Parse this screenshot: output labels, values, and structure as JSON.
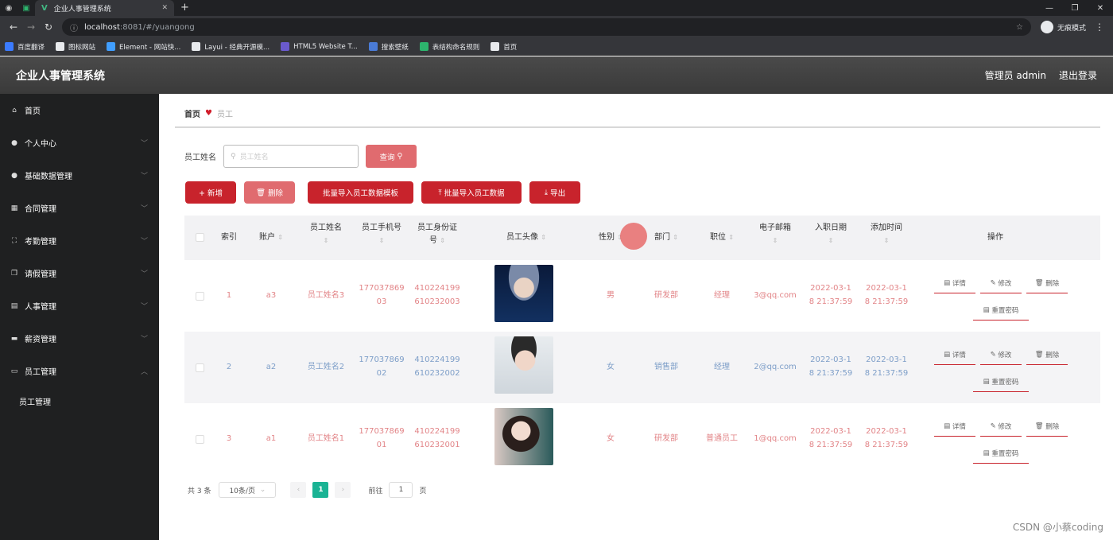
{
  "browser": {
    "tab_title": "企业人事管理系统",
    "url_host": "localhost",
    "url_path": ":8081/#/yuangong",
    "incognito_label": "无痕模式",
    "bookmarks": [
      {
        "label": "百度翻译",
        "color": "#3b7bff"
      },
      {
        "label": "图标网站",
        "color": "#e8eaed"
      },
      {
        "label": "Element - 网站快...",
        "color": "#409eff"
      },
      {
        "label": "Layui - 经典开源模...",
        "color": "#e8eaed"
      },
      {
        "label": "HTML5 Website T...",
        "color": "#6a5acd"
      },
      {
        "label": "搜索壁纸",
        "color": "#4a7bd6"
      },
      {
        "label": "表结构命名规则",
        "color": "#2db46d"
      },
      {
        "label": "首页",
        "color": "#e8eaed"
      }
    ]
  },
  "header": {
    "title": "企业人事管理系统",
    "user": "管理员 admin",
    "logout": "退出登录"
  },
  "sidebar": {
    "items": [
      {
        "label": "首页",
        "icon": "home-icon",
        "glyph": "⌂",
        "chevron": false
      },
      {
        "label": "个人中心",
        "icon": "user-icon",
        "glyph": "●",
        "chevron": true
      },
      {
        "label": "基础数据管理",
        "icon": "user-icon",
        "glyph": "●",
        "chevron": true
      },
      {
        "label": "合同管理",
        "icon": "calendar-icon",
        "glyph": "▦",
        "chevron": true
      },
      {
        "label": "考勤管理",
        "icon": "fullscreen-icon",
        "glyph": "⛶",
        "chevron": true
      },
      {
        "label": "请假管理",
        "icon": "copy-icon",
        "glyph": "❐",
        "chevron": true
      },
      {
        "label": "人事管理",
        "icon": "document-icon",
        "glyph": "▤",
        "chevron": true
      },
      {
        "label": "薪资管理",
        "icon": "wallet-icon",
        "glyph": "▬",
        "chevron": true
      },
      {
        "label": "员工管理",
        "icon": "message-icon",
        "glyph": "▭",
        "chevron": true,
        "open": true
      }
    ],
    "sub_item": "员工管理"
  },
  "breadcrumb": {
    "home": "首页",
    "current": "员工"
  },
  "search": {
    "label": "员工姓名",
    "placeholder": "员工姓名",
    "button": "查询"
  },
  "toolbar": {
    "add": "+ 新增",
    "delete": "删除",
    "template": "批量导入员工数据模板",
    "import": "批量导入员工数据",
    "export": "导出"
  },
  "table": {
    "headers": {
      "index": "索引",
      "account": "账户",
      "name": "员工姓名",
      "phone": "员工手机号",
      "idcard_1": "员工身份证",
      "idcard_2": "号",
      "photo": "员工头像",
      "gender": "性别",
      "dept": "部门",
      "position": "职位",
      "email": "电子邮箱",
      "hire_date": "入职日期",
      "added": "添加时间",
      "ops": "操作"
    },
    "rows": [
      {
        "index": "1",
        "account": "a3",
        "name": "员工姓名3",
        "phone_1": "177037869",
        "phone_2": "03",
        "id_1": "410224199",
        "id_2": "610232003",
        "gender": "男",
        "dept": "研发部",
        "position": "经理",
        "email": "3@qq.com",
        "hire_1": "2022-03-1",
        "hire_2": "8 21:37:59",
        "add_1": "2022-03-1",
        "add_2": "8 21:37:59",
        "color": "#e28487",
        "avatar": "avatar-1"
      },
      {
        "index": "2",
        "account": "a2",
        "name": "员工姓名2",
        "phone_1": "177037869",
        "phone_2": "02",
        "id_1": "410224199",
        "id_2": "610232002",
        "gender": "女",
        "dept": "销售部",
        "position": "经理",
        "email": "2@qq.com",
        "hire_1": "2022-03-1",
        "hire_2": "8 21:37:59",
        "add_1": "2022-03-1",
        "add_2": "8 21:37:59",
        "color": "#7d9ec8",
        "avatar": "avatar-2"
      },
      {
        "index": "3",
        "account": "a1",
        "name": "员工姓名1",
        "phone_1": "177037869",
        "phone_2": "01",
        "id_1": "410224199",
        "id_2": "610232001",
        "gender": "女",
        "dept": "研发部",
        "position": "普通员工",
        "email": "1@qq.com",
        "hire_1": "2022-03-1",
        "hire_2": "8 21:37:59",
        "add_1": "2022-03-1",
        "add_2": "8 21:37:59",
        "color": "#e28487",
        "avatar": "avatar-3"
      }
    ],
    "ops": {
      "detail": "详情",
      "edit": "修改",
      "delete": "删除",
      "reset": "重置密码"
    }
  },
  "pagination": {
    "total": "共 3 条",
    "page_size": "10条/页",
    "current": "1",
    "goto_prefix": "前往",
    "goto_value": "1",
    "goto_suffix": "页"
  },
  "watermark": "CSDN @小蔡coding"
}
